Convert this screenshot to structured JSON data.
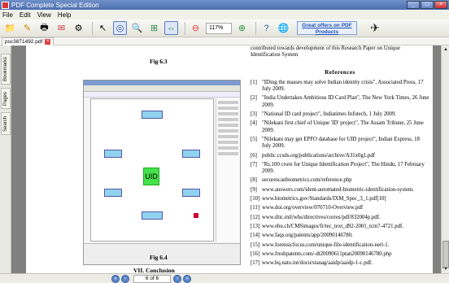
{
  "window": {
    "title": "PDF Complete Special Edition"
  },
  "menu": [
    "File",
    "Edit",
    "View",
    "Help"
  ],
  "toolbar": {
    "zoom": "117%",
    "offer": "Great offers on PDF Products"
  },
  "tab": {
    "filename": "psc3871492.pdf"
  },
  "sidebar": [
    "Bookmarks",
    "Pages",
    "Search"
  ],
  "page": {
    "fig1_caption": "Fig 6.3",
    "fig2_caption": "Fig 6.4",
    "section_heading": "VII. Conclusion",
    "screenshot_labels": {
      "center": "UID"
    },
    "intro_text": "contributed towards development of this Research Paper on Unique Identification System",
    "references_title": "References",
    "references": [
      {
        "num": "[1]",
        "text": "\"IDing the masses may solve Indian identity crisis\", Associated Press, 17 July 2009."
      },
      {
        "num": "[2]",
        "text": "\"India Undertakes Ambitious ID Card Plan\", The New York Times, 26 June 2009."
      },
      {
        "num": "[3]",
        "text": "\"National ID card project\", Indiatimes Infotech, 1 July 2009."
      },
      {
        "num": "[4]",
        "text": "\"Nilekani first chief of Unique 'ID' project\", The Assam Tribune, 25 June 2009."
      },
      {
        "num": "[5]",
        "text": "\"Nilekani may get EPFO database for UID project\", Indian Express, 18 July 2009."
      },
      {
        "num": "[6]",
        "text": "public.ccsds.org/publications/archive/A31x0g1.pdf"
      },
      {
        "num": "[7]",
        "text": "\"Rs.100 crore for Unique Identification Project\", The Hindu, 17 February 2009."
      },
      {
        "num": "[8]",
        "text": "securescanbiometrics.com/reference.php"
      },
      {
        "num": "[9]",
        "text": "www.answers.com/ident-automated-biometric-identification-system."
      },
      {
        "num": "[10]",
        "text": "www.biometrics.gov/Standards/IXM_Spec_3_1.pdf[10]"
      },
      {
        "num": "[11]",
        "text": "www.doi.org/overview/070710-Overview.pdf"
      },
      {
        "num": "[12]",
        "text": "www.dtic.mil/whs/directives/corres/pdf/832004p.pdf."
      },
      {
        "num": "[13]",
        "text": "www.ebu.ch/CMSimages/fr/tec_text_d92-2001_tcm7-4721.pdf."
      },
      {
        "num": "[14]",
        "text": "www.faqs.org/patents/app/20090146780."
      },
      {
        "num": "[15]",
        "text": "www.forensicfocus.com/unique-file-identification-nerl-1."
      },
      {
        "num": "[16]",
        "text": "www.freshpatents.com/-dt20090611ptan20090146780.php"
      },
      {
        "num": "[17]",
        "text": "www.hq.nato.int/docu/stanag/aaidp/aaidp-1-c.pdf."
      }
    ]
  },
  "status": {
    "page_indicator": "6 of 6"
  }
}
